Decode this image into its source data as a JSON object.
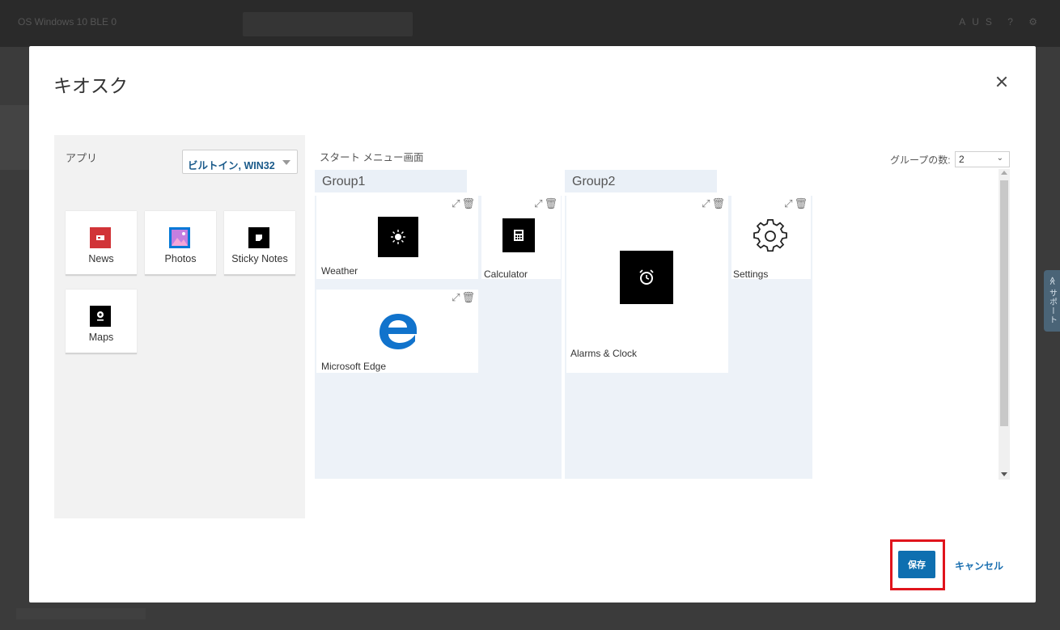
{
  "background": {
    "title": "OS Windows 10 BLE 0",
    "right_tools": "AUS  ?  ⚙"
  },
  "support_tab": {
    "label": "≪ サポート"
  },
  "dialog": {
    "title": "キオスク",
    "apps": {
      "label": "アプリ",
      "selected": "ビルトイン, WIN32",
      "items": [
        {
          "name": "News",
          "icon": "news-icon",
          "color": "#d13438"
        },
        {
          "name": "Photos",
          "icon": "photos-icon",
          "color": "#0078d7"
        },
        {
          "name": "Sticky Notes",
          "icon": "sticky-notes-icon",
          "color": "#000000"
        },
        {
          "name": "Maps",
          "icon": "maps-icon",
          "color": "#000000"
        }
      ]
    },
    "start_menu": {
      "label": "スタート メニュー画面",
      "groups": [
        {
          "name": "Group1",
          "tiles": [
            {
              "name": "Weather",
              "icon": "weather-icon"
            },
            {
              "name": "Calculator",
              "icon": "calculator-icon"
            },
            {
              "name": "Microsoft Edge",
              "icon": "edge-icon"
            }
          ]
        },
        {
          "name": "Group2",
          "tiles": [
            {
              "name": "Alarms & Clock",
              "icon": "alarm-clock-icon"
            },
            {
              "name": "Settings",
              "icon": "settings-gear-icon"
            }
          ]
        }
      ]
    },
    "group_count": {
      "label": "グループの数:",
      "value": "2"
    },
    "buttons": {
      "save": "保存",
      "cancel": "キャンセル"
    },
    "accent_color": "#0e6fb0",
    "highlight_color": "#e0141c"
  }
}
